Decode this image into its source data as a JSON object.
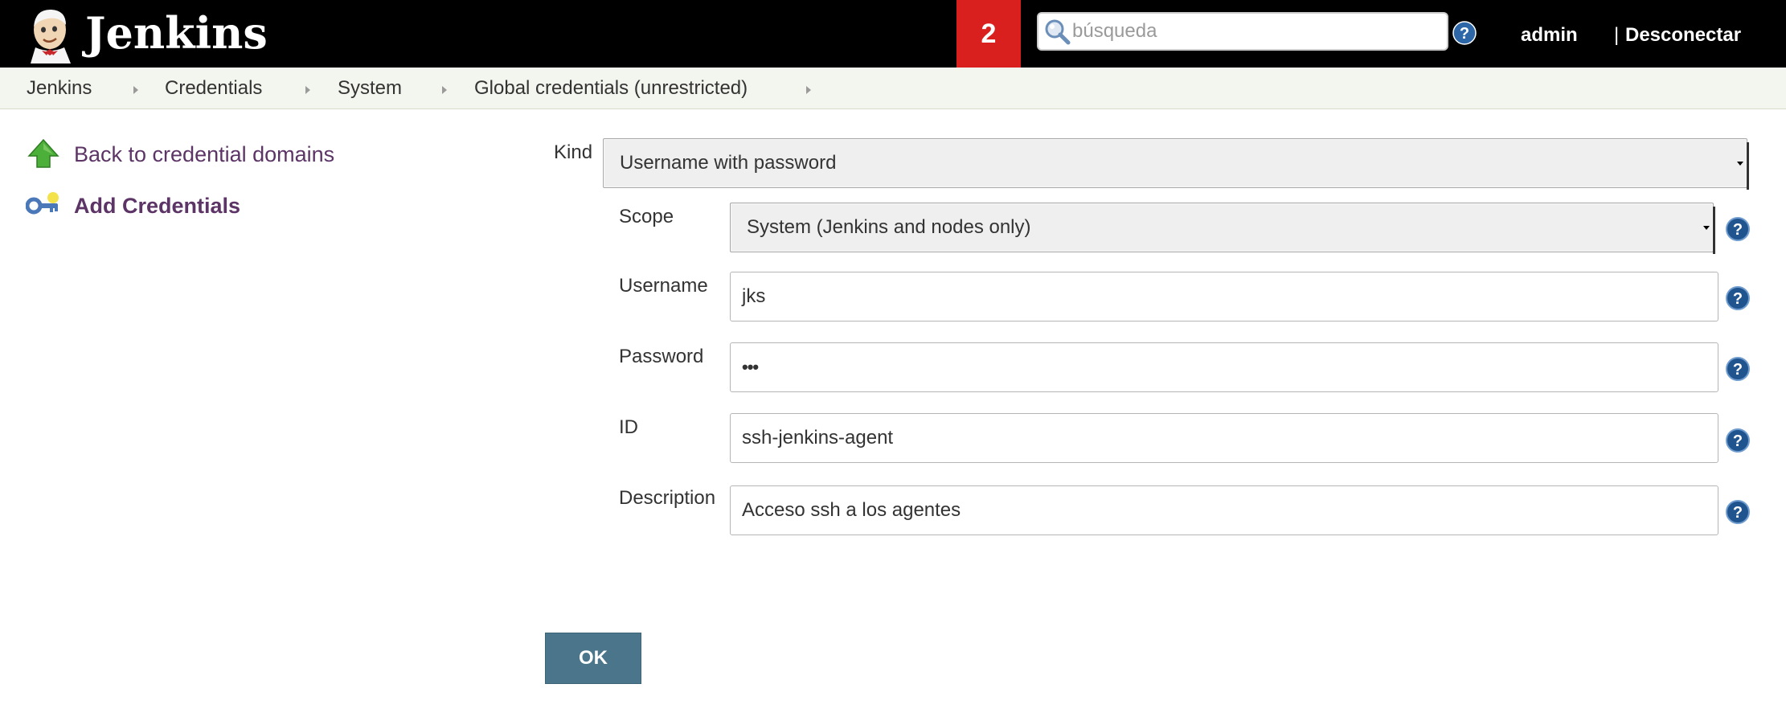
{
  "header": {
    "logo_text": "Jenkins",
    "notification_count": "2",
    "search_placeholder": "búsqueda",
    "user": "admin",
    "separator": "|",
    "logout": "Desconectar"
  },
  "breadcrumb": [
    {
      "label": "Jenkins"
    },
    {
      "label": "Credentials"
    },
    {
      "label": "System"
    },
    {
      "label": "Global credentials (unrestricted)"
    }
  ],
  "sidebar": {
    "items": [
      {
        "label": "Back to credential domains",
        "icon": "up-arrow-icon"
      },
      {
        "label": "Add Credentials",
        "icon": "key-icon"
      }
    ]
  },
  "form": {
    "kind": {
      "label": "Kind",
      "value": "Username with password"
    },
    "scope": {
      "label": "Scope",
      "value": "System (Jenkins and nodes only)"
    },
    "username": {
      "label": "Username",
      "value": "jks"
    },
    "password": {
      "label": "Password",
      "value": "•••"
    },
    "id": {
      "label": "ID",
      "value": "ssh-jenkins-agent"
    },
    "description": {
      "label": "Description",
      "value": "Acceso ssh a los agentes"
    },
    "ok_label": "OK"
  },
  "colors": {
    "header_bg": "#000000",
    "notification_bg": "#d9201e",
    "breadcrumb_bg": "#f3f6ee",
    "link": "#5c3566",
    "button_bg": "#4b758b",
    "help_icon": "#20548e"
  }
}
